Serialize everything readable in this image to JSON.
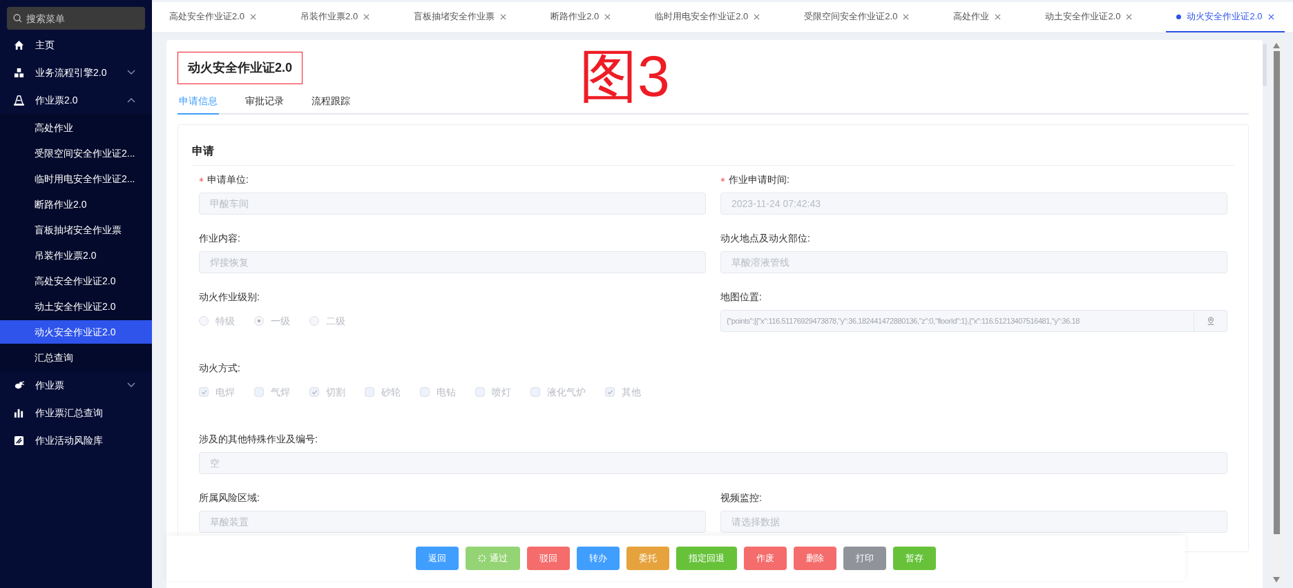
{
  "sidebar": {
    "search": {
      "placeholder": "搜索菜单"
    },
    "items": [
      {
        "label": "主页",
        "selected": false
      },
      {
        "label": "业务流程引擎2.0",
        "expanded": false,
        "selected": false
      },
      {
        "label": "作业票2.0",
        "expanded": true,
        "selected": false,
        "children": [
          {
            "label": "高处作业",
            "selected": false
          },
          {
            "label": "受限空间安全作业证2...",
            "selected": false
          },
          {
            "label": "临时用电安全作业证2...",
            "selected": false
          },
          {
            "label": "断路作业2.0",
            "selected": false
          },
          {
            "label": "盲板抽堵安全作业票",
            "selected": false
          },
          {
            "label": "吊装作业票2.0",
            "selected": false
          },
          {
            "label": "高处安全作业证2.0",
            "selected": false
          },
          {
            "label": "动土安全作业证2.0",
            "selected": false
          },
          {
            "label": "动火安全作业证2.0",
            "selected": true
          },
          {
            "label": "汇总查询",
            "selected": false
          }
        ]
      },
      {
        "label": "作业票",
        "expanded": false,
        "selected": false
      },
      {
        "label": "作业票汇总查询",
        "selected": false
      },
      {
        "label": "作业活动风险库",
        "selected": false
      }
    ]
  },
  "tabs": [
    {
      "label": "高处安全作业证2.0",
      "selected": false
    },
    {
      "label": "吊装作业票2.0",
      "selected": false
    },
    {
      "label": "盲板抽堵安全作业票",
      "selected": false
    },
    {
      "label": "断路作业2.0",
      "selected": false
    },
    {
      "label": "临时用电安全作业证2.0",
      "selected": false
    },
    {
      "label": "受限空间安全作业证2.0",
      "selected": false
    },
    {
      "label": "高处作业",
      "selected": false
    },
    {
      "label": "动土安全作业证2.0",
      "selected": false
    },
    {
      "label": "动火安全作业证2.0",
      "selected": true
    }
  ],
  "page": {
    "title": "动火安全作业证2.0",
    "highlighted": true,
    "annotation": "图3",
    "tabs": [
      {
        "label": "申请信息",
        "selected": true
      },
      {
        "label": "审批记录",
        "selected": false
      },
      {
        "label": "流程跟踪",
        "selected": false
      }
    ]
  },
  "section": {
    "title": "申请",
    "disabled": true,
    "rows": [
      [
        {
          "kind": "text",
          "label": "申请单位:",
          "required": true,
          "value": "甲酸车间"
        },
        {
          "kind": "text",
          "label": "作业申请时间:",
          "required": true,
          "value": "2023-11-24 07:42:43"
        }
      ],
      [
        {
          "kind": "text",
          "label": "作业内容:",
          "required": false,
          "value": "焊接恢复"
        },
        {
          "kind": "text",
          "label": "动火地点及动火部位:",
          "required": false,
          "value": "草酸溶液管线"
        }
      ],
      [
        {
          "kind": "radio",
          "label": "动火作业级别:",
          "options": [
            {
              "label": "特级",
              "selected": false
            },
            {
              "label": "一级",
              "selected": true
            },
            {
              "label": "二级",
              "selected": false
            }
          ]
        },
        {
          "kind": "map",
          "label": "地图位置:",
          "value": "{\"points\":[{\"x\":116.51176929473878,\"y\":36.182441472880136,\"z\":0,\"floorId\":1},{\"x\":116.51213407516481,\"y\":36.18"
        }
      ],
      [
        {
          "kind": "checkbox",
          "label": "动火方式:",
          "options": [
            {
              "label": "电焊",
              "checked": true
            },
            {
              "label": "气焊",
              "checked": false
            },
            {
              "label": "切割",
              "checked": true
            },
            {
              "label": "砂轮",
              "checked": false
            },
            {
              "label": "电钻",
              "checked": false
            },
            {
              "label": "喷灯",
              "checked": false
            },
            {
              "label": "液化气炉",
              "checked": false
            },
            {
              "label": "其他",
              "checked": true
            }
          ]
        }
      ],
      [
        {
          "kind": "text",
          "label": "涉及的其他特殊作业及编号:",
          "required": false,
          "value": "空"
        }
      ],
      [
        {
          "kind": "text",
          "label": "所属风险区域:",
          "required": false,
          "value": "草酸装置"
        },
        {
          "kind": "select",
          "label": "视频监控:",
          "placeholder": "请选择数据"
        }
      ]
    ]
  },
  "actions": [
    {
      "label": "返回",
      "color": "#409eff",
      "loading": false
    },
    {
      "label": "通过",
      "color": "#95d475",
      "loading": true
    },
    {
      "label": "驳回",
      "color": "#f56c6c",
      "loading": false
    },
    {
      "label": "转办",
      "color": "#409eff",
      "loading": false
    },
    {
      "label": "委托",
      "color": "#e6a23c",
      "loading": false
    },
    {
      "label": "指定回退",
      "color": "#67c23a",
      "loading": false
    },
    {
      "label": "作废",
      "color": "#f56c6c",
      "loading": false
    },
    {
      "label": "删除",
      "color": "#f56c6c",
      "loading": false
    },
    {
      "label": "打印",
      "color": "#909399",
      "loading": false
    },
    {
      "label": "暂存",
      "color": "#67c23a",
      "loading": false
    }
  ]
}
